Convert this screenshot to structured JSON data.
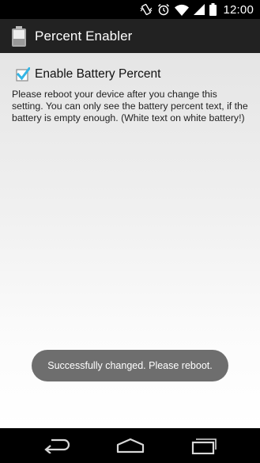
{
  "status_bar": {
    "time": "12:00",
    "icons": [
      "vibrate-icon",
      "alarm-icon",
      "wifi-icon",
      "cell-signal-icon",
      "battery-icon"
    ]
  },
  "action_bar": {
    "title": "Percent Enabler",
    "icon": "battery-icon"
  },
  "setting": {
    "label": "Enable Battery Percent",
    "checked": true,
    "description": "Please reboot your device after you change this setting. You can only see the battery percent text, if the battery is empty enough. (White text on white battery!)"
  },
  "toast": {
    "message": "Successfully changed. Please reboot."
  },
  "nav_bar": {
    "buttons": [
      "back-icon",
      "home-icon",
      "recents-icon"
    ]
  },
  "colors": {
    "accent": "#33b5e5",
    "action_bar": "#222222",
    "toast": "#6e6e6e"
  }
}
